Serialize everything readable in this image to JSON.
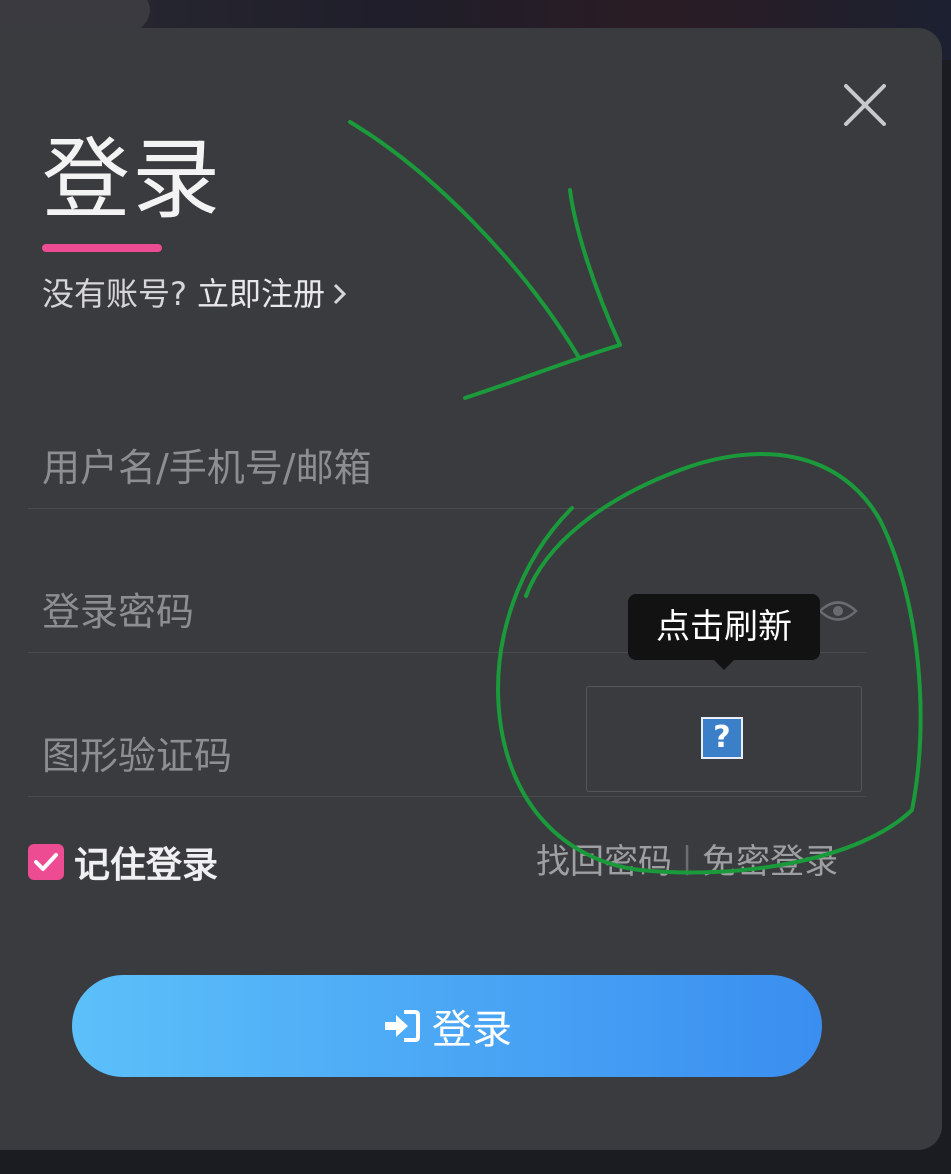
{
  "login": {
    "title": "登录",
    "no_account": "没有账号?",
    "register_link": "立即注册",
    "username_placeholder": "用户名/手机号/邮箱",
    "password_placeholder": "登录密码",
    "captcha_placeholder": "图形验证码",
    "captcha_tooltip": "点击刷新",
    "captcha_image_alt": "?",
    "remember_label": "记住登录",
    "remember_checked": true,
    "forgot_password": "找回密码",
    "separator": "|",
    "passwordless_login": "免密登录",
    "submit_label": "登录"
  },
  "icons": {
    "close": "close-icon",
    "chevron": "chevron-right-icon",
    "eye": "eye-icon",
    "checkbox": "checkmark-icon",
    "submit": "sign-in-icon"
  },
  "colors": {
    "accent": "#ee4c92",
    "button_start": "#5cc0fa",
    "button_end": "#3a8ef0",
    "modal_bg": "#3a3b3e",
    "annotation": "#1a9a3a"
  }
}
